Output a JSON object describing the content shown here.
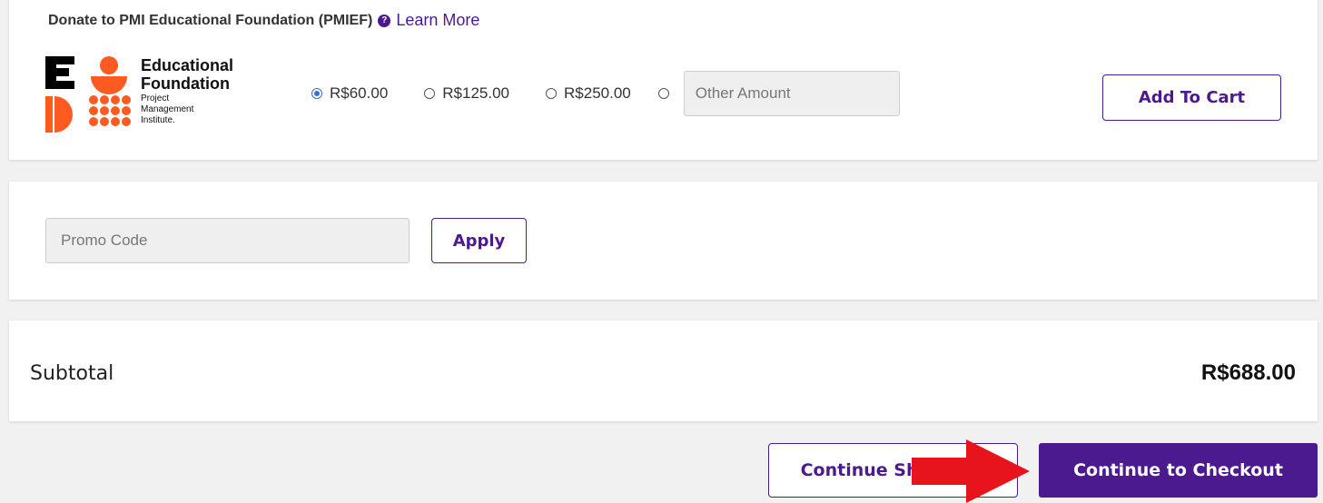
{
  "donation": {
    "heading": "Donate to PMI Educational Foundation (PMIEF)",
    "help_icon": "?",
    "learn_more": "Learn More",
    "logo": {
      "line1": "Educational",
      "line2": "Foundation",
      "sub1": "Project",
      "sub2": "Management",
      "sub3": "Institute."
    },
    "options": [
      {
        "label": "R$60.00",
        "selected": true
      },
      {
        "label": "R$125.00",
        "selected": false
      },
      {
        "label": "R$250.00",
        "selected": false
      }
    ],
    "other_placeholder": "Other Amount",
    "add_to_cart": "Add To Cart"
  },
  "promo": {
    "placeholder": "Promo Code",
    "apply": "Apply"
  },
  "summary": {
    "subtotal_label": "Subtotal",
    "subtotal_value": "R$688.00"
  },
  "actions": {
    "continue_shopping": "Continue Shopping",
    "checkout": "Continue to Checkout"
  },
  "colors": {
    "brand_purple": "#4b1a8f",
    "logo_orange": "#ff5a1f",
    "annotation_red": "#e8141c"
  }
}
